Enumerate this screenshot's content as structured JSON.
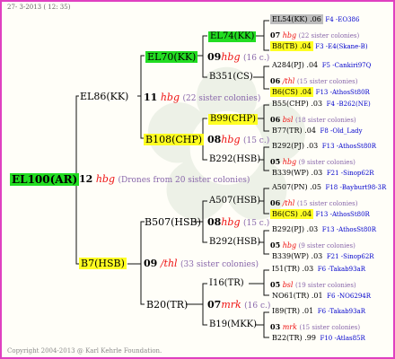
{
  "header": "27-  3-2013 ( 12: 35)",
  "copyright": "Copyright 2004-2013 @ Karl Kehrle Foundation.",
  "root": {
    "name": "EL100(AR)",
    "num": "12",
    "hbg": "hbg",
    "sis": "(Drones from 20 sister colonies)"
  },
  "g1": [
    {
      "name": "EL86(KK)",
      "num": "11",
      "hbg": "hbg",
      "sis": "(22 sister colonies)"
    },
    {
      "name": "B7(HSB)",
      "num": "09",
      "hbg": "/thl",
      "sis": "(33 sister colonies)"
    }
  ],
  "g2": [
    {
      "name": "EL70(KK)",
      "num": "09",
      "hbg": "hbg",
      "sis": "(16 c.)"
    },
    {
      "name": "B108(CHP)",
      "num": "08",
      "hbg": "hbg",
      "sis": "(15 c.)"
    },
    {
      "name": "B507(HSB)",
      "num": "08",
      "hbg": "hbg",
      "sis": "(15 c.)"
    },
    {
      "name": "B20(TR)",
      "num": "07",
      "hbg": "mrk",
      "sis": "(16 c.)"
    }
  ],
  "g3": [
    {
      "name": "EL74(KK)"
    },
    {
      "name": "B351(CS)"
    },
    {
      "name": "B99(CHP)"
    },
    {
      "name": "B292(HSB)"
    },
    {
      "name": "A507(HSB)"
    },
    {
      "name": "B292(HSB)"
    },
    {
      "name": "I16(TR)"
    },
    {
      "name": "B19(MKK)"
    }
  ],
  "g4": [
    {
      "top": "EL54(KK) .06",
      "topcode": "F4 -EO386",
      "num": "07",
      "hbg": "hbg",
      "sis": "(22 sister colonies)",
      "bot": "B8(TB) .04",
      "botcode": "F3 -E4(Skane-B)"
    },
    {
      "top": "A284(PJ) .04",
      "topcode": "F5 -Cankiri97Q",
      "num": "06",
      "hbg": "/thl",
      "sis": "(15 sister colonies)",
      "bot": "B6(CS) .04",
      "botcode": "F13 -AthosSt80R"
    },
    {
      "top": "B55(CHP) .03",
      "topcode": "F4 -B262(NE)",
      "num": "06",
      "hbg": "bsl",
      "sis": "(18 sister colonies)",
      "bot": "B77(TR) .04",
      "botcode": "F8 -Old_Lady"
    },
    {
      "top": "B292(PJ) .03",
      "topcode": "F13 -AthosSt80R",
      "num": "05",
      "hbg": "hbg",
      "sis": "(9 sister colonies)",
      "bot": "B339(WP) .03",
      "botcode": "F21 -Sinop62R"
    },
    {
      "top": "A507(PN) .05",
      "topcode": "F18 -Bayburt98-3R",
      "num": "06",
      "hbg": "/thl",
      "sis": "(15 sister colonies)",
      "bot": "B6(CS) .04",
      "botcode": "F13 -AthosSt80R"
    },
    {
      "top": "B292(PJ) .03",
      "topcode": "F13 -AthosSt80R",
      "num": "05",
      "hbg": "hbg",
      "sis": "(9 sister colonies)",
      "bot": "B339(WP) .03",
      "botcode": "F21 -Sinop62R"
    },
    {
      "top": "I51(TR) .03",
      "topcode": "F6 -Takab93aR",
      "num": "05",
      "hbg": "bsl",
      "sis": "(19 sister colonies)",
      "bot": "NO61(TR) .01",
      "botcode": "F6 -NO6294R"
    },
    {
      "top": "I89(TR) .01",
      "topcode": "F6 -Takab93aR",
      "num": "03",
      "hbg": "mrk",
      "sis": "(15 sister colonies)",
      "bot": "B22(TR) .99",
      "botcode": "F10 -Atlas85R"
    }
  ],
  "colors": {
    "frame": "#e040c0",
    "green": "#22dd22",
    "yellow": "#ffff22",
    "gray": "#bdbdbd",
    "hbg": "#ee1111",
    "blue": "#0000cc"
  }
}
